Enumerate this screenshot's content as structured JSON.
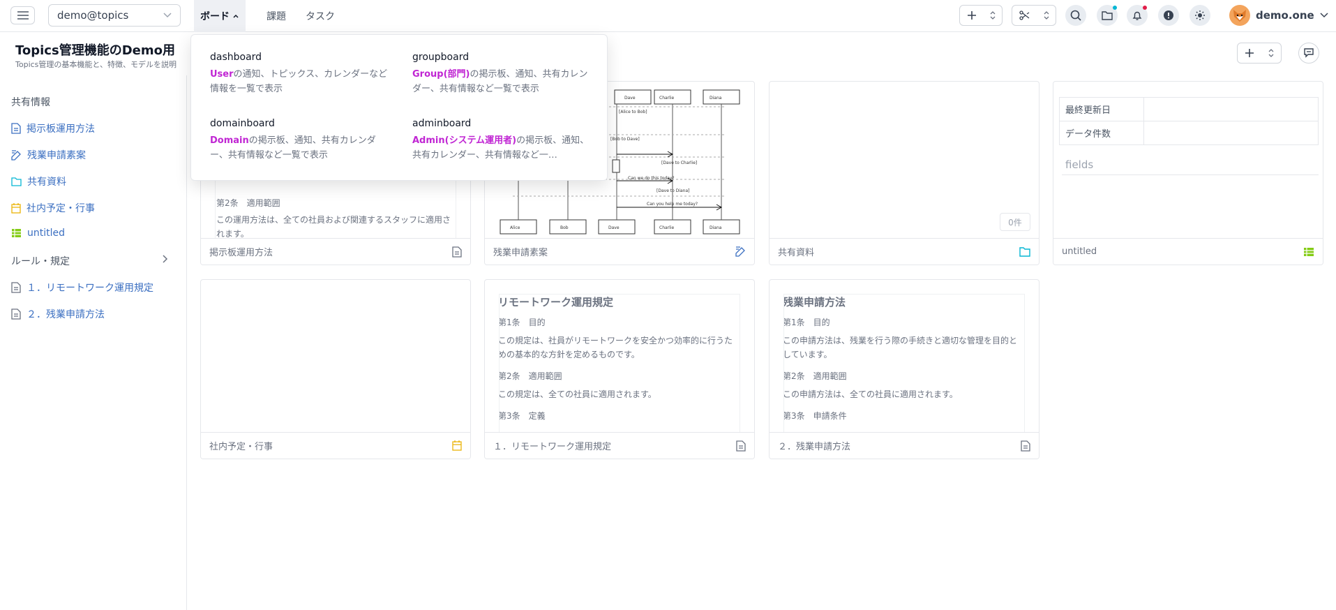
{
  "topbar": {
    "workspace": "demo@topics",
    "nav": {
      "board": "ボード",
      "kadai": "課題",
      "task": "タスク"
    },
    "user_name": "demo.one",
    "notify_dot_color": "#e11d48",
    "folder_dot_color": "#06b6d4"
  },
  "header": {
    "title": "Topics管理機能のDemo用",
    "subtitle": "Topics管理の基本機能と、特徴、モデルを説明"
  },
  "sidebar": {
    "section_shared": "共有情報",
    "items": [
      {
        "label": "掲示板運用方法",
        "icon": "document-icon"
      },
      {
        "label": "残業申請素案",
        "icon": "pen-edit-icon"
      },
      {
        "label": "共有資料",
        "icon": "folder-icon"
      },
      {
        "label": "社内予定・行事",
        "icon": "calendar-icon"
      },
      {
        "label": "untitled",
        "icon": "table-icon"
      }
    ],
    "section_rules": "ルール・規定",
    "rules": [
      {
        "label": "１．リモートワーク運用規定",
        "icon": "document-icon"
      },
      {
        "label": "２．残業申請方法",
        "icon": "document-icon"
      }
    ]
  },
  "dropdown": {
    "items": [
      {
        "title": "dashboard",
        "hl": "User",
        "desc": "の通知、トピックス、カレンダーなど情報を一覧で表示"
      },
      {
        "title": "groupboard",
        "hl": "Group(部門)",
        "desc": "の掲示板、通知、共有カレンダー、共有情報など一覧で表示"
      },
      {
        "title": "domainboard",
        "hl": "Domain",
        "desc": "の掲示板、通知、共有カレンダー、共有情報など一覧で表示"
      },
      {
        "title": "adminboard",
        "hl": "Admin(システム運用者)",
        "desc": "の掲示板、通知、共有カレンダー、共有情報など一…"
      }
    ]
  },
  "cards": {
    "c1": {
      "footer": "掲示板運用方法",
      "head": "第2条　適用範囲",
      "body": "この運用方法は、全ての社員および関連するスタッフに適用されます。"
    },
    "c2": {
      "footer": "残業申請素案",
      "actors": [
        "Alice",
        "Bob",
        "Dave",
        "Charlie",
        "Diana"
      ],
      "messages": [
        "[Alice to Bob]",
        "[Bob to Dave]",
        "[Dave to Charlie]",
        "Can we do this today?",
        "[Dave to Diana]",
        "Can you help me today?"
      ]
    },
    "c3": {
      "footer": "共有資料",
      "count": "0件"
    },
    "c4": {
      "footer": "untitled",
      "row1": "最終更新日",
      "row2": "データ件数",
      "fields": "fields"
    },
    "c5": {
      "footer": "社内予定・行事"
    },
    "c6": {
      "footer": "１．リモートワーク運用規定",
      "title": "リモートワーク運用規定",
      "s1": "第1条　目的",
      "b1": "この規定は、社員がリモートワークを安全かつ効率的に行うための基本的な方針を定めるものです。",
      "s2": "第2条　適用範囲",
      "b2": "この規定は、全ての社員に適用されます。",
      "s3": "第3条　定義"
    },
    "c7": {
      "footer": "２．残業申請方法",
      "title": "残業申請方法",
      "s1": "第1条　目的",
      "b1": "この申請方法は、残業を行う際の手続きと適切な管理を目的としています。",
      "s2": "第2条　適用範囲",
      "b2": "この申請方法は、全ての社員に適用されます。",
      "s3": "第3条　申請条件"
    }
  },
  "colors": {
    "link": "#3b6fc1",
    "highlight": "#c026d3",
    "calendar": "#eab308",
    "table": "#84cc16",
    "folder": "#06b6d4",
    "pen": "#3b6fc1"
  }
}
